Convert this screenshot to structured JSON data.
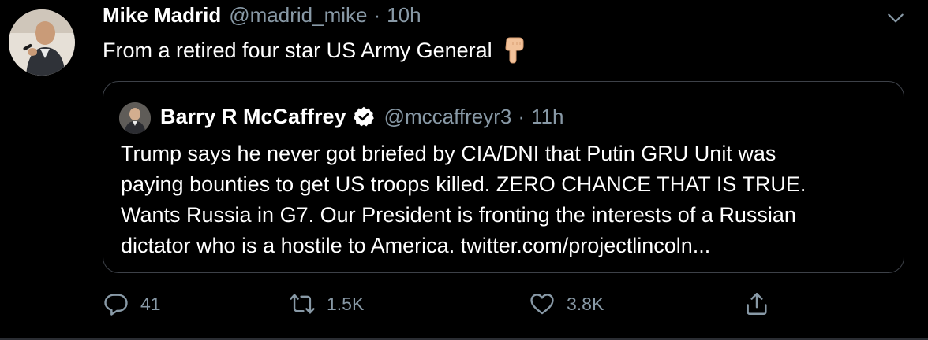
{
  "author": {
    "name": "Mike Madrid",
    "handle": "@madrid_mike",
    "separator": "·",
    "time": "10h"
  },
  "tweet": {
    "text": "From a retired four star US Army General",
    "emoji": "backhand-index-pointing-down"
  },
  "quoted": {
    "name": "Barry R McCaffrey",
    "verified": true,
    "handle": "@mccaffreyr3",
    "separator": "·",
    "time": "11h",
    "lines": [
      "Trump says he never got briefed by CIA/DNI that Putin GRU Unit was",
      "paying bounties to get US troops killed. ZERO CHANCE THAT IS TRUE.",
      "Wants Russia in G7. Our President is fronting the interests of a Russian",
      "dictator who is a hostile to America. twitter.com/projectlincoln..."
    ]
  },
  "actions": {
    "reply_count": "41",
    "retweet_count": "1.5K",
    "like_count": "3.8K"
  },
  "colors": {
    "background": "#000000",
    "text": "#ffffff",
    "muted": "#8899a6",
    "border": "#3d4148"
  }
}
